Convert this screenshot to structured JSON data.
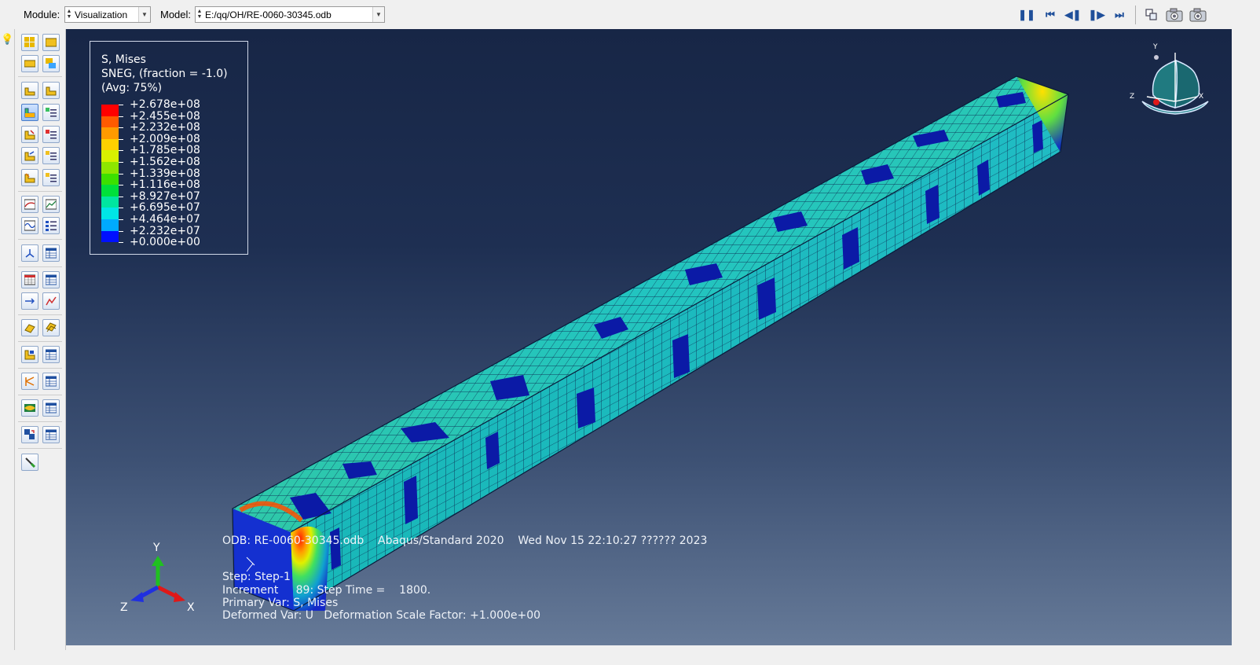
{
  "toolbar": {
    "module_label": "Module:",
    "module_value": "Visualization",
    "model_label": "Model:",
    "model_value": "E:/qq/OH/RE-0060-30345.odb",
    "anim": {
      "pause": "❚❚",
      "first": "⏮",
      "prev": "◀❚",
      "next": "❚▶",
      "last": "⏭"
    }
  },
  "legend": {
    "title": "S, Mises",
    "subtitle": "SNEG, (fraction = -1.0)",
    "avg": "(Avg: 75%)",
    "entries": [
      {
        "value": "+2.678e+08",
        "color": "#ff0000"
      },
      {
        "value": "+2.455e+08",
        "color": "#ff5a00"
      },
      {
        "value": "+2.232e+08",
        "color": "#ff9a00"
      },
      {
        "value": "+2.009e+08",
        "color": "#ffd000"
      },
      {
        "value": "+1.785e+08",
        "color": "#d8f000"
      },
      {
        "value": "+1.562e+08",
        "color": "#8ee600"
      },
      {
        "value": "+1.339e+08",
        "color": "#3ce000"
      },
      {
        "value": "+1.116e+08",
        "color": "#00e03a"
      },
      {
        "value": "+8.927e+07",
        "color": "#00e6a0"
      },
      {
        "value": "+6.695e+07",
        "color": "#00e6e6"
      },
      {
        "value": "+4.464e+07",
        "color": "#00aaff"
      },
      {
        "value": "+2.232e+07",
        "color": "#0060ff"
      },
      {
        "value": "+0.000e+00",
        "color": "#0010ff"
      }
    ]
  },
  "info": {
    "odb_line": "ODB: RE-0060-30345.odb    Abaqus/Standard 2020    Wed Nov 15 22:10:27 ?????? 2023",
    "step_line": "Step: Step-1",
    "increment_line": "Increment     89: Step Time =    1800.",
    "primary_line": "Primary Var: S, Mises",
    "deformed_line": "Deformed Var: U   Deformation Scale Factor: +1.000e+00"
  },
  "triad": {
    "x": "X",
    "y": "Y",
    "z": "Z"
  },
  "colors": {
    "viewport_top": "#172646",
    "viewport_bottom": "#667a98",
    "beam_face": "#1cc6b4",
    "band": "#0b1aa6"
  }
}
